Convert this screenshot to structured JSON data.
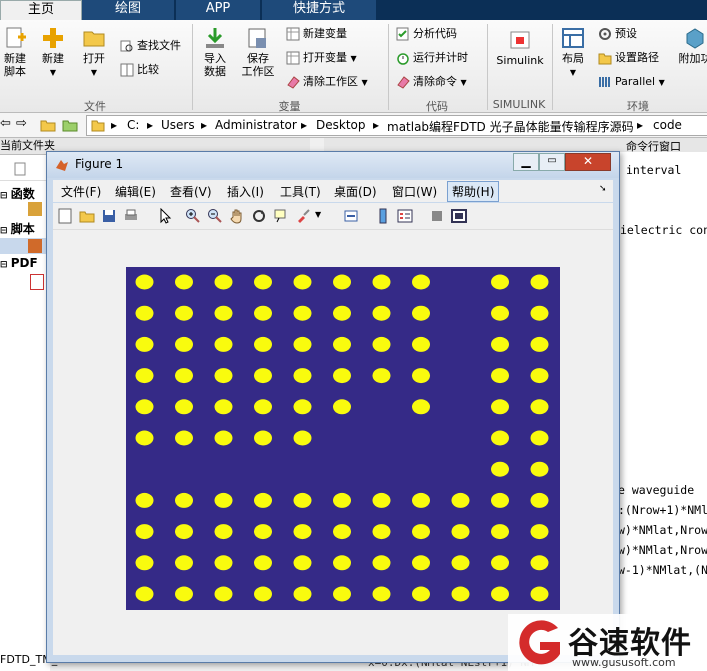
{
  "ribbon_tabs": {
    "home": "主页",
    "plots": "绘图",
    "apps": "APP",
    "shortcuts": "快捷方式"
  },
  "ribbon": {
    "new_script": "新建\n脚本",
    "new": "新建",
    "open": "打开",
    "find_files": "查找文件",
    "compare": "比较",
    "import_data": "导入\n数据",
    "save_workspace": "保存\n工作区",
    "new_variable": "新建变量",
    "open_variable": "打开变量",
    "clear_workspace": "清除工作区",
    "analyze_code": "分析代码",
    "run_and_time": "运行并计时",
    "clear_commands": "清除命令",
    "simulink": "Simulink",
    "layout": "布局",
    "preferences": "预设",
    "set_path": "设置路径",
    "parallel": "Parallel",
    "addons": "附加功",
    "groups": {
      "file": "文件",
      "variable": "变量",
      "code": "代码",
      "simulink": "SIMULINK",
      "environment": "环境"
    }
  },
  "address": {
    "crumbs": [
      "C:",
      "Users",
      "Administrator",
      "Desktop",
      "matlab编程FDTD 光子晶体能量传输程序源码",
      "code"
    ]
  },
  "left_panel": {
    "title": "当前文件夹",
    "items": [
      "函数",
      "脚本",
      "PDF"
    ],
    "footer": "FDTD_TM_Crm"
  },
  "cmd_panel": {
    "title": "命令行窗口",
    "lines": [
      "interval",
      "ielectric con",
      "e waveguide",
      ":(Nrow+1)*NMl",
      "w)*NMlat,Nrow",
      "w)*NMlat,Nrow",
      "w-1)*NMlat,(N"
    ],
    "bottom_line": "x=0:Dx:(NMlat*NLstr+1)*NM"
  },
  "figure": {
    "title": "Figure 1",
    "menus": [
      "文件(F)",
      "编辑(E)",
      "查看(V)",
      "插入(I)",
      "工具(T)",
      "桌面(D)",
      "窗口(W)",
      "帮助(H)"
    ],
    "background_color": "#352a87",
    "dot_color": "#f9fb0e",
    "lattice": {
      "columns": 11,
      "rows": 11,
      "missing": [
        [
          0,
          8
        ],
        [
          1,
          8
        ],
        [
          2,
          8
        ],
        [
          3,
          8
        ],
        [
          4,
          8
        ],
        [
          5,
          8
        ],
        [
          6,
          8
        ],
        [
          6,
          0
        ],
        [
          6,
          1
        ],
        [
          6,
          2
        ],
        [
          6,
          3
        ],
        [
          6,
          4
        ],
        [
          6,
          5
        ],
        [
          6,
          6
        ],
        [
          6,
          7
        ],
        [
          4,
          6
        ],
        [
          5,
          6
        ],
        [
          5,
          7
        ],
        [
          5,
          5
        ]
      ]
    }
  },
  "watermark": {
    "brand": "谷速软件",
    "url": "www.gususoft.com"
  }
}
